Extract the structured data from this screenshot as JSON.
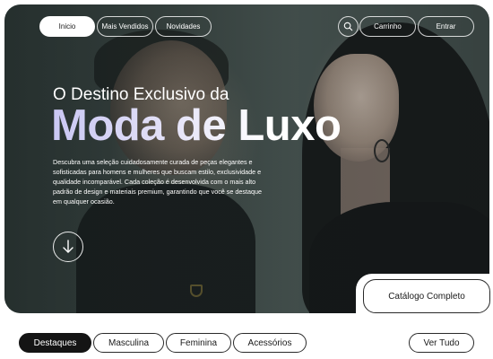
{
  "nav": {
    "items": [
      {
        "label": "Inicio",
        "active": true
      },
      {
        "label": "Mais Vendidos",
        "active": false
      },
      {
        "label": "Novidades",
        "active": false
      }
    ],
    "search_icon": "search-icon",
    "cart_label": "Carrinho",
    "login_label": "Entrar"
  },
  "hero": {
    "subtitle": "O Destino Exclusivo da",
    "title": "Moda de Luxo",
    "description": "Descubra uma seleção cuidadosamente curada de peças elegantes e sofisticadas para homens e mulheres que buscam estilo, exclusividade e qualidade incomparável. Cada coleção é desenvolvida com o mais alto padrão de design e materiais premium, garantindo que você se destaque em qualquer ocasião.",
    "scroll_icon": "arrow-down-icon",
    "catalog_label": "Catálogo Completo"
  },
  "categories": {
    "tabs": [
      {
        "label": "Destaques",
        "active": true
      },
      {
        "label": "Masculina",
        "active": false
      },
      {
        "label": "Feminina",
        "active": false
      },
      {
        "label": "Acessórios",
        "active": false
      }
    ],
    "view_all_label": "Ver Tudo"
  },
  "colors": {
    "accent_dark": "#141414",
    "title_gradient_start": "#c9c6f3",
    "hero_bg": "#46524f"
  }
}
